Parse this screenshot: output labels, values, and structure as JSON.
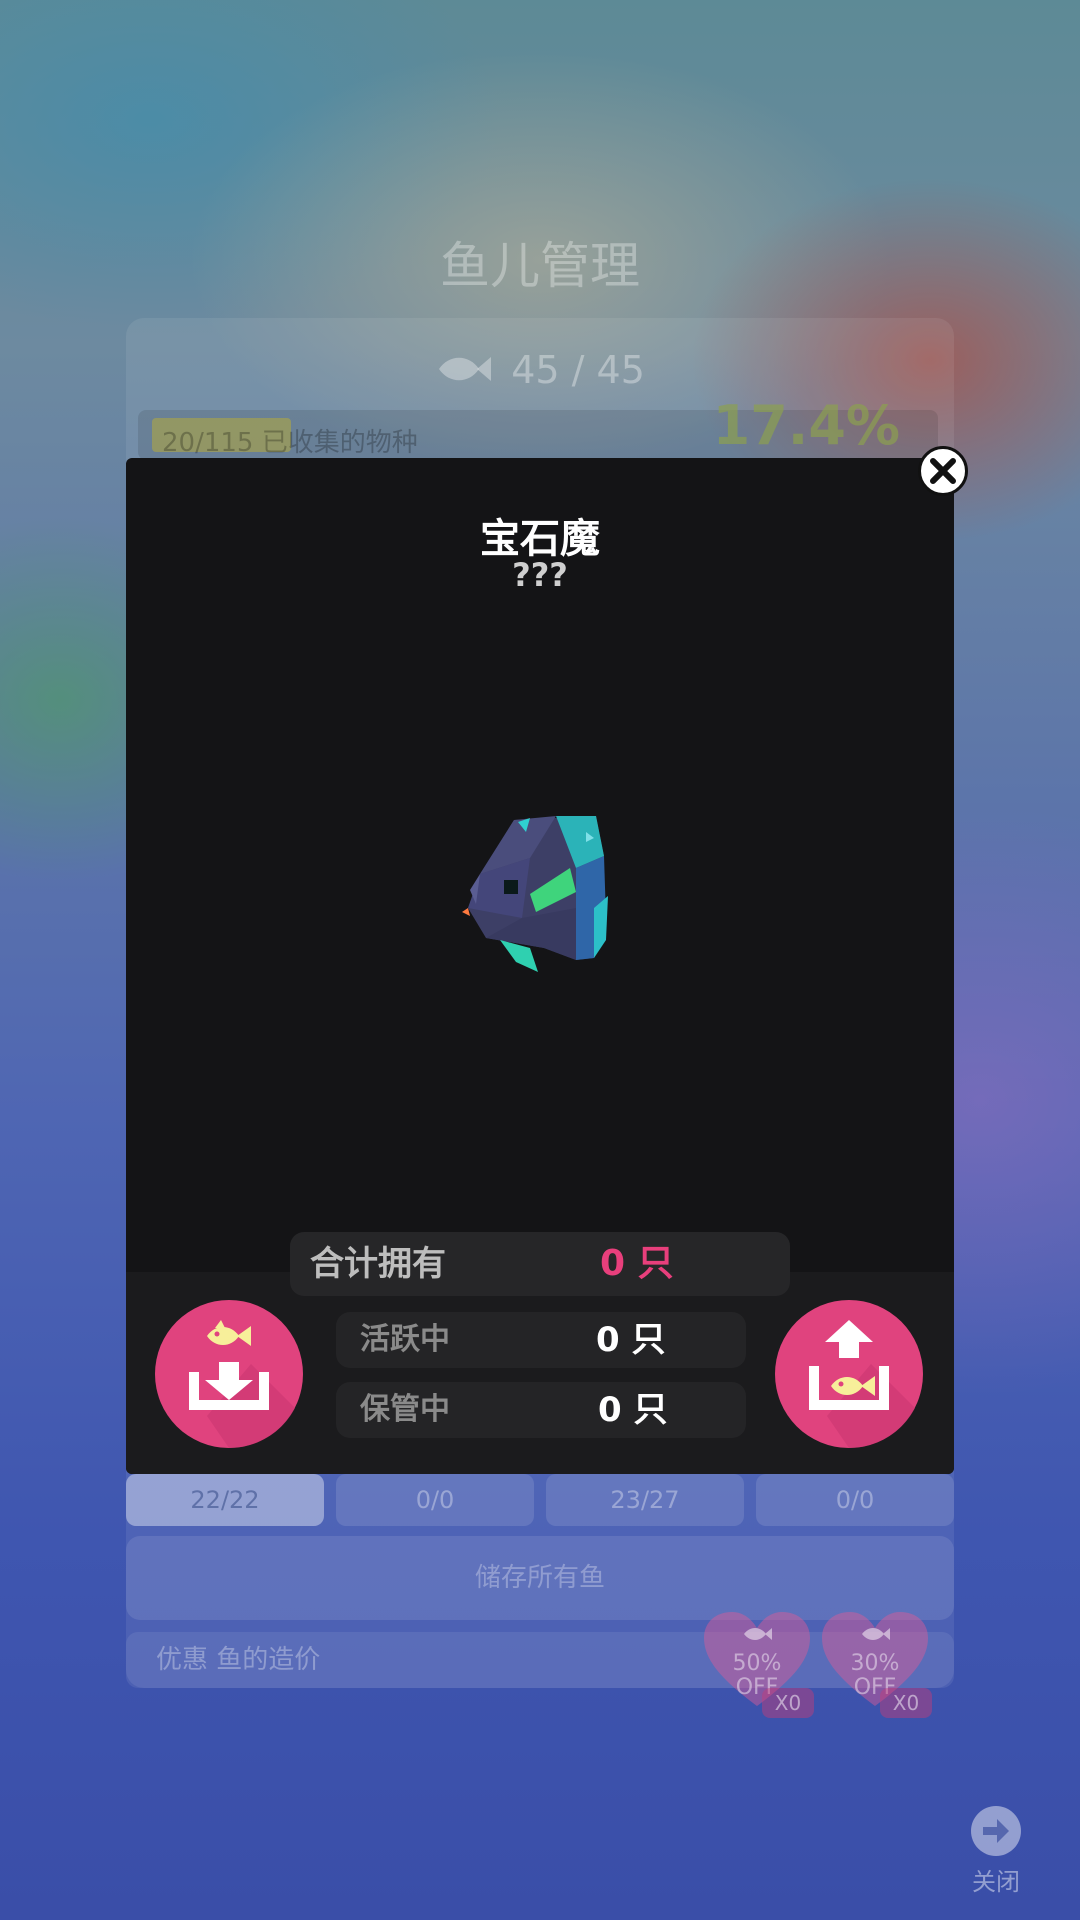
{
  "background": {
    "title": "鱼儿管理",
    "fish_count": "45 / 45",
    "progress_label": "20/115 已收集的物种",
    "progress_fraction": 0.174,
    "progress_percent": "17.4%",
    "tabs": [
      "22/22",
      "0/0",
      "23/27",
      "0/0"
    ],
    "store_all_label": "储存所有鱼",
    "discount_label": "优惠 鱼的造价",
    "coupons": [
      {
        "percent": "50%",
        "off": "OFF",
        "count": "X0"
      },
      {
        "percent": "30%",
        "off": "OFF",
        "count": "X0"
      }
    ],
    "close_label": "关闭"
  },
  "dialog": {
    "name": "宝石魔",
    "subtitle": "???",
    "stats": {
      "total_label": "合计拥有",
      "total_value": "0 只",
      "active_label": "活跃中",
      "active_value": "0 只",
      "stored_label": "保管中",
      "stored_value": "0 只"
    }
  },
  "colors": {
    "accent_pink": "#e83f7c",
    "dialog_bg": "#141416",
    "button_pink": "#e0437e"
  },
  "icons": {
    "close": "close-icon",
    "store": "store-fish-icon",
    "release": "release-fish-icon"
  }
}
